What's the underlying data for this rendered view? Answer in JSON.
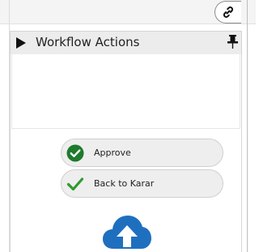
{
  "toolbar": {
    "link_icon": "link-icon"
  },
  "panel": {
    "title": "Workflow Actions",
    "collapse_icon": "triangle-right-icon",
    "pin_icon": "pin-icon"
  },
  "actions": [
    {
      "label": "Approve",
      "icon": "check-circle-icon",
      "color": "#2e7d32"
    },
    {
      "label": "Back to Karar",
      "icon": "checkmark-icon",
      "color": "#2e9a2e"
    }
  ],
  "upload": {
    "icon": "cloud-upload-icon",
    "color": "#1f6fbf"
  }
}
